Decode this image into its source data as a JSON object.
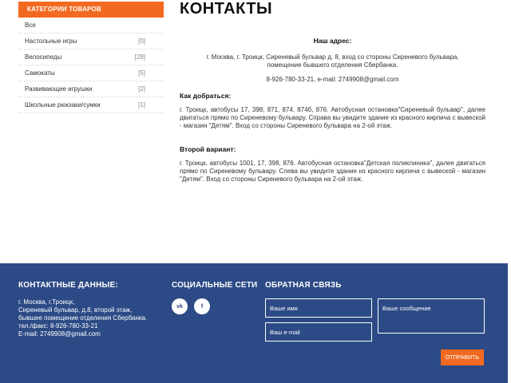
{
  "sidebar": {
    "header": "КАТЕГОРИИ ТОВАРОВ",
    "items": [
      {
        "label": "Все",
        "count": ""
      },
      {
        "label": "Настольные игры",
        "count": "[0]"
      },
      {
        "label": "Велосипеды",
        "count": "[28]"
      },
      {
        "label": "Самокаты",
        "count": "[5]"
      },
      {
        "label": "Развивающие игрушки",
        "count": "[2]"
      },
      {
        "label": "Школьные рюкзаки/сумки",
        "count": "[1]"
      }
    ]
  },
  "main": {
    "title": "КОНТАКТЫ",
    "address_heading": "Наш адрес:",
    "address_line1": "г. Москва, г. Троицк, Сиреневый бульвар д. 8, вход со стороны Сиреневого бульвара,",
    "address_line2": "помещение бывшего отделения Сбербанка.",
    "phone_email": "8-926-780-33-21, e-mail: 2749908@gmail.com",
    "route1_heading": "Как добраться:",
    "route1_text": "г. Троицк, автобусы 17, 398, 871, 874, 874б, 876. Автобусная остановка\"Сиреневый бульвар\", далее двигаться прямо по Сиреневому бульвару. Справа вы увидите здание из красного кирпича с вывеской - магазин \"Детям\". Вход со стороны Сиреневого бульвара на 2-ой этаж.",
    "route2_heading": "Второй вариант:",
    "route2_text": "г. Троицк, автобусы 1001, 17, 398, 876. Автобусная остановка\"Детская поликлиника\", далее двигаться прямо по Сиреневому бульвару. Слева вы увидите здание из красного кирпича с вывеской - магазин \"Детям\". Вход со стороны Сиреневого бульвара на 2-ой этаж."
  },
  "footer": {
    "contacts_title": "КОНТАКТНЫЕ ДАННЫЕ:",
    "contacts_lines": [
      "г. Москва, г.Троицк,",
      "Сиреневый бульвар, д.8, второй этаж,",
      "бывшее помещение отделения Сбербанка.",
      "тел./факс: 8-926-780-33-21",
      "E-mail: 2749908@gmail.com"
    ],
    "social_title": "СОЦИАЛЬНЫЕ СЕТИ",
    "social_vk": "vk",
    "social_fb": "f",
    "feedback_title": "ОБРАТНАЯ СВЯЗЬ",
    "name_placeholder": "Ваше имя",
    "email_placeholder": "Ваш e-mail",
    "message_placeholder": "Ваше сообщение",
    "submit_label": "ОТПРАВИТЬ"
  },
  "colors": {
    "accent": "#f26a21",
    "footer_bg": "#2c4a85"
  }
}
